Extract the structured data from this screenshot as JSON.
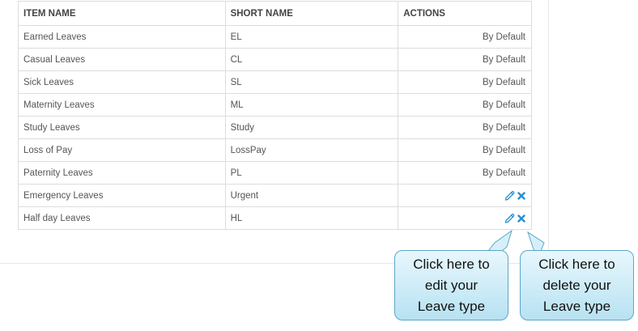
{
  "table": {
    "headers": {
      "item_name": "ITEM NAME",
      "short_name": "SHORT NAME",
      "actions": "ACTIONS"
    },
    "rows": [
      {
        "item_name": "Earned Leaves",
        "short_name": "EL",
        "action": "By Default"
      },
      {
        "item_name": "Casual Leaves",
        "short_name": "CL",
        "action": "By Default"
      },
      {
        "item_name": "Sick Leaves",
        "short_name": "SL",
        "action": "By Default"
      },
      {
        "item_name": "Maternity Leaves",
        "short_name": "ML",
        "action": "By Default"
      },
      {
        "item_name": "Study Leaves",
        "short_name": "Study",
        "action": "By Default"
      },
      {
        "item_name": "Loss of Pay",
        "short_name": "LossPay",
        "action": "By Default"
      },
      {
        "item_name": "Paternity Leaves",
        "short_name": "PL",
        "action": "By Default"
      },
      {
        "item_name": "Emergency Leaves",
        "short_name": "Urgent",
        "action_icons": [
          "pencil-icon",
          "close-icon"
        ]
      },
      {
        "item_name": "Half day Leaves",
        "short_name": "HL",
        "action_icons": [
          "pencil-icon",
          "close-icon"
        ]
      }
    ]
  },
  "callouts": {
    "edit": {
      "line1": "Click here to",
      "line2": "edit your",
      "line3": "Leave type"
    },
    "delete": {
      "line1": "Click here to",
      "line2": "delete your",
      "line3": "Leave type"
    }
  },
  "colors": {
    "icon_blue": "#2a8fd0",
    "callout_border": "#5aa7c8",
    "callout_fill": "#c9ebf7"
  }
}
